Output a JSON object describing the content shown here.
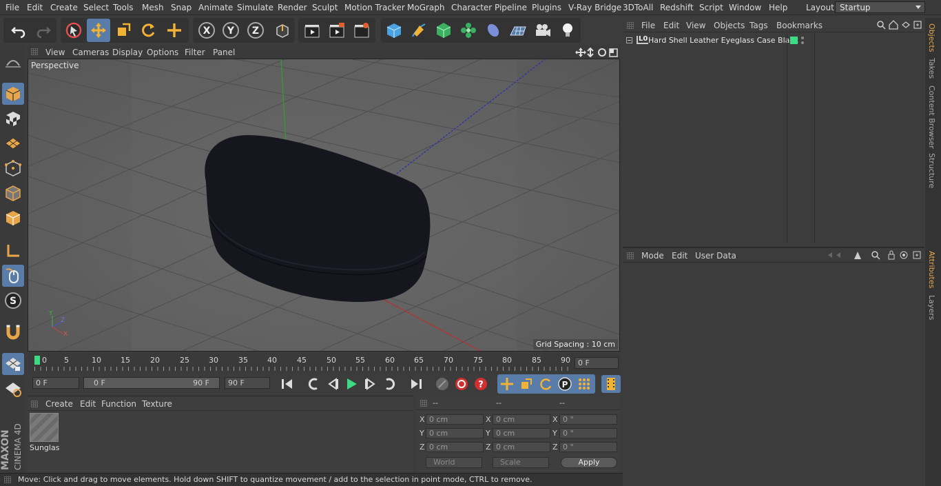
{
  "menubar": {
    "items": [
      "File",
      "Edit",
      "Create",
      "Select",
      "Tools",
      "Mesh",
      "Snap",
      "Animate",
      "Simulate",
      "Render",
      "Sculpt",
      "Motion Tracker",
      "MoGraph",
      "Character",
      "Pipeline",
      "Plugins",
      "V-Ray Bridge",
      "3DToAll",
      "Redshift",
      "Script",
      "Window",
      "Help"
    ],
    "layout_label": "Layout:",
    "layout_value": "Startup"
  },
  "viewport": {
    "menu": [
      "View",
      "Cameras",
      "Display",
      "Options",
      "Filter",
      "Panel"
    ],
    "label": "Perspective",
    "grid_spacing": "Grid Spacing : 10 cm",
    "axis_y": "Y",
    "axis_z": "Z",
    "axis_x": "X"
  },
  "timeline": {
    "ticks": [
      "0",
      "5",
      "10",
      "15",
      "20",
      "25",
      "30",
      "35",
      "40",
      "45",
      "50",
      "55",
      "60",
      "65",
      "70",
      "75",
      "80",
      "85",
      "90"
    ],
    "current_frame": "0 F",
    "start_field": "0 F",
    "range_start": "0 F",
    "range_end": "90 F",
    "end_field": "90 F"
  },
  "materials": {
    "menu": [
      "Create",
      "Edit",
      "Function",
      "Texture"
    ],
    "material_name": "Sunglas"
  },
  "coordinates": {
    "headers": [
      "--",
      "--",
      "--"
    ],
    "rows": [
      {
        "axis": "X",
        "pos": "0 cm",
        "size": "0 cm",
        "rot": "0 °"
      },
      {
        "axis": "Y",
        "pos": "0 cm",
        "size": "0 cm",
        "rot": "0 °"
      },
      {
        "axis": "Z",
        "pos": "0 cm",
        "size": "0 cm",
        "rot": "0 °"
      }
    ],
    "world_label": "World",
    "scale_label": "Scale",
    "apply_label": "Apply"
  },
  "statusbar": {
    "text": "Move: Click and drag to move elements. Hold down SHIFT to quantize movement / add to the selection in point mode, CTRL to remove."
  },
  "objects": {
    "menu": [
      "File",
      "Edit",
      "View",
      "Objects",
      "Tags",
      "Bookmarks"
    ],
    "object_name": "Hard Shell Leather Eyeglass Case Black",
    "object_badge": "L0"
  },
  "attributes": {
    "menu": [
      "Mode",
      "Edit",
      "User Data"
    ]
  },
  "sidetabs": [
    "Objects",
    "Takes",
    "Content Browser",
    "Structure",
    "Attributes",
    "Layers"
  ],
  "brand": {
    "line1": "MAXON",
    "line2": "CINEMA 4D"
  },
  "colors": {
    "accent": "#5a7ca8",
    "tab_active": "#e8a64a",
    "object_tag": "#3ddc84",
    "case": "#16161f"
  }
}
